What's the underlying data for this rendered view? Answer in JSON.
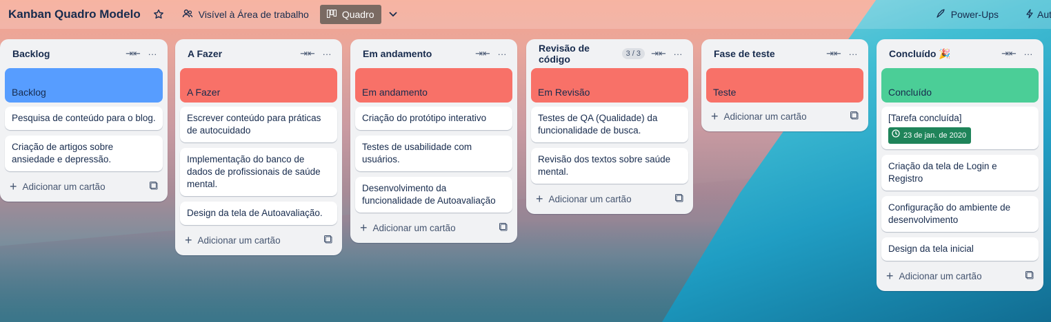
{
  "header": {
    "board_title": "Kanban Quadro Modelo",
    "visibility_label": "Visível à Área de trabalho",
    "view_label": "Quadro",
    "powerups_label": "Power-Ups",
    "automation_label": "Automação"
  },
  "colors": {
    "cover_blue": "#579dff",
    "cover_red": "#f87168",
    "cover_green": "#4bce97",
    "badge_green": "#1f845a"
  },
  "add_card_label": "Adicionar um cartão",
  "lists": [
    {
      "title": "Backlog",
      "cover": "Backlog",
      "cards": [
        "Pesquisa de conteúdo para o blog.",
        "Criação de artigos sobre ansiedade e depressão."
      ]
    },
    {
      "title": "A Fazer",
      "cover": "A Fazer",
      "cards": [
        "Escrever conteúdo para práticas de autocuidado",
        "Implementação do banco de dados de profissionais de saúde mental.",
        "Design da tela de Autoavaliação."
      ]
    },
    {
      "title": "Em andamento",
      "cover": "Em andamento",
      "cards": [
        "Criação do protótipo interativo",
        "Testes de usabilidade com usuários.",
        "Desenvolvimento da funcionalidade de Autoavaliação"
      ]
    },
    {
      "title": "Revisão de código",
      "count": "3 / 3",
      "cover": "Em Revisão",
      "cards": [
        "Testes de QA (Qualidade) da funcionalidade de busca.",
        "Revisão dos textos sobre saúde mental."
      ]
    },
    {
      "title": "Fase de teste",
      "cover": "Teste",
      "cards": []
    },
    {
      "title": "Concluído 🎉",
      "cover": "Concluído",
      "cards": [
        "[Tarefa concluída]",
        "Criação da tela de Login e Registro",
        "Configuração do ambiente de desenvolvimento",
        "Design da tela inicial"
      ],
      "badge": "23 de jan. de 2020"
    }
  ]
}
